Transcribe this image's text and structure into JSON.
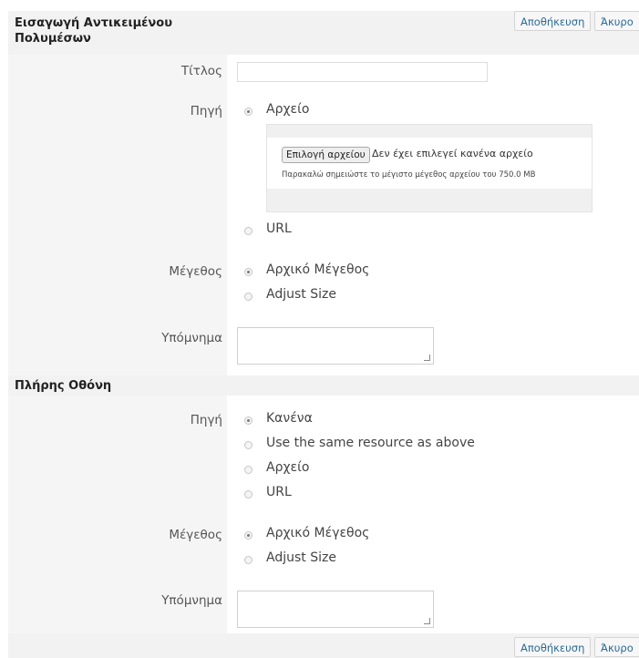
{
  "media_section": {
    "title_line1": "Εισαγωγή Αντικειμένου",
    "title_line2": "Πολυμέσων",
    "save_label": "Αποθήκευση",
    "cancel_label": "Άκυρο",
    "title_label": "Τίτλος",
    "source_label": "Πηγή",
    "source_options": [
      "Αρχείο",
      "URL"
    ],
    "choose_file_label": "Επιλογή αρχείου",
    "no_file_text": "Δεν έχει επιλεγεί κανένα αρχείο",
    "max_size_note": "Παρακαλώ σημειώστε το μέγιστο μέγεθος αρχείου του 750.0 MB",
    "size_label": "Μέγεθος",
    "size_options": [
      "Αρχικό Μέγεθος",
      "Adjust Size"
    ],
    "caption_label": "Υπόμνημα"
  },
  "fullscreen_section": {
    "title": "Πλήρης Οθόνη",
    "source_label": "Πηγή",
    "source_options": [
      "Κανένα",
      "Use the same resource as above",
      "Αρχείο",
      "URL"
    ],
    "size_label": "Μέγεθος",
    "size_options": [
      "Αρχικό Μέγεθος",
      "Adjust Size"
    ],
    "caption_label": "Υπόμνημα"
  },
  "footer": {
    "save_label": "Αποθήκευση",
    "cancel_label": "Άκυρο"
  }
}
